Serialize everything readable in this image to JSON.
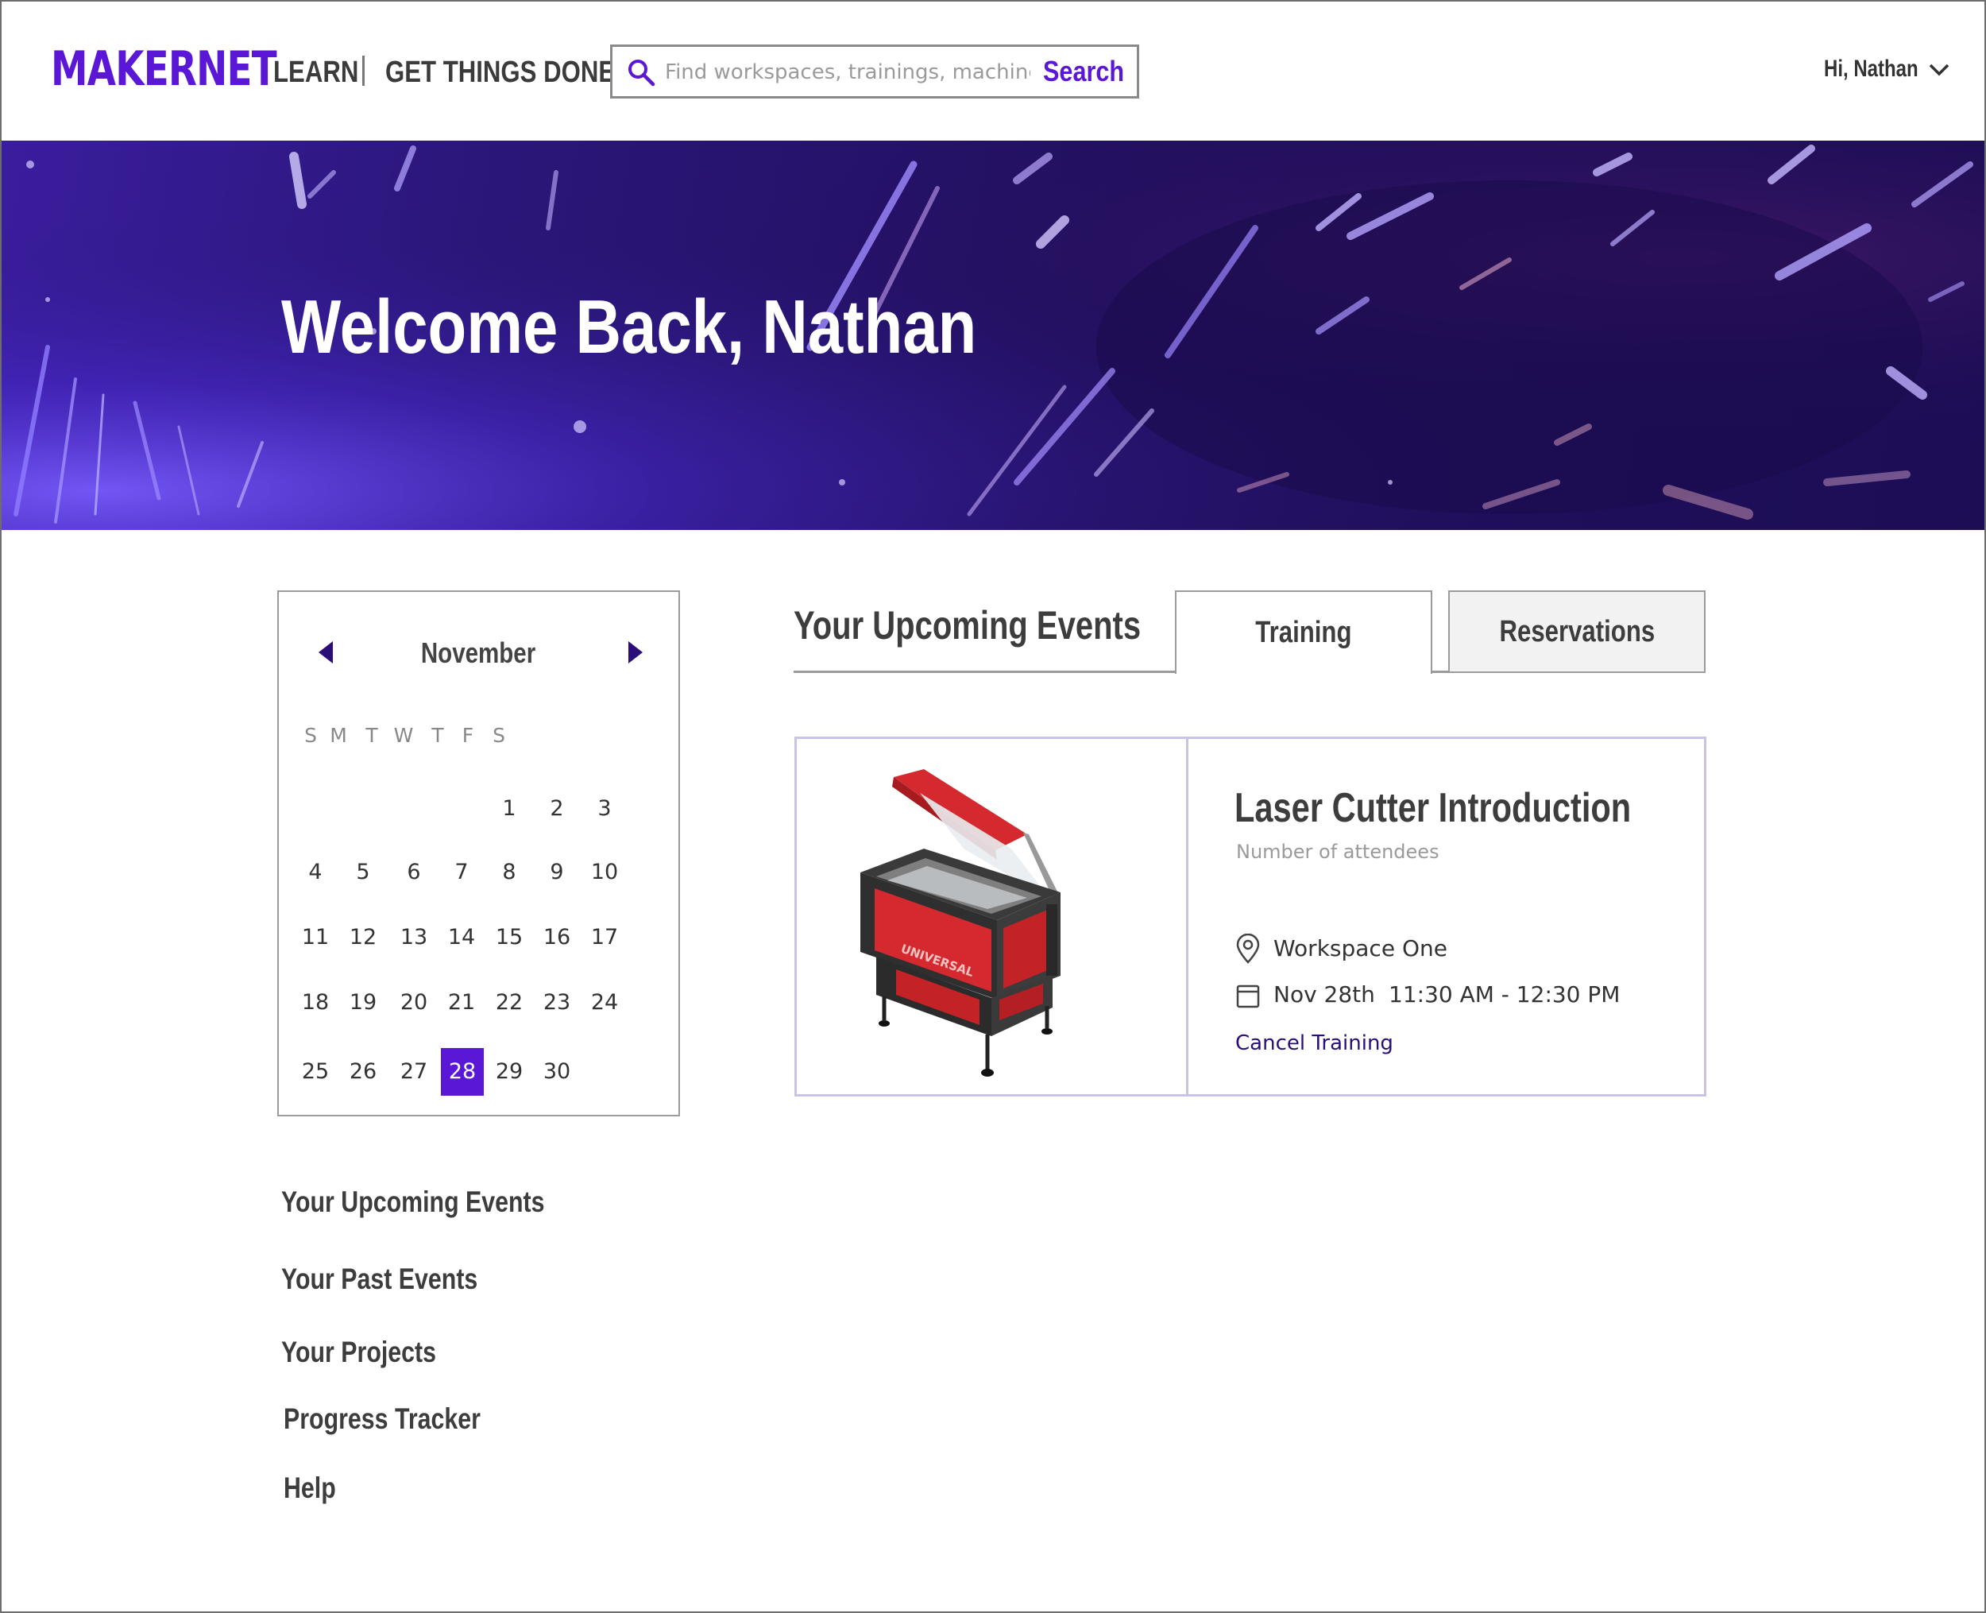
{
  "header": {
    "logo": "MAKERNET",
    "nav": {
      "learn": "LEARN",
      "get_things_done": "GET THINGS DONE"
    },
    "search": {
      "placeholder": "Find workspaces, trainings, machines ...",
      "button": "Search"
    },
    "user": {
      "greeting": "Hi, Nathan"
    }
  },
  "hero": {
    "title": "Welcome Back, Nathan"
  },
  "calendar": {
    "month": "November",
    "weekdays": [
      "S",
      "M",
      "T",
      "W",
      "T",
      "F",
      "S"
    ],
    "weeks": [
      [
        "",
        "",
        "",
        "",
        "1",
        "2",
        "3"
      ],
      [
        "4",
        "5",
        "6",
        "7",
        "8",
        "9",
        "10"
      ],
      [
        "11",
        "12",
        "13",
        "14",
        "15",
        "16",
        "17"
      ],
      [
        "18",
        "19",
        "20",
        "21",
        "22",
        "23",
        "24"
      ],
      [
        "25",
        "26",
        "27",
        "28",
        "29",
        "30",
        ""
      ]
    ],
    "selected": "28"
  },
  "sidebar": {
    "items": [
      {
        "label": "Your Upcoming Events",
        "active": true
      },
      {
        "label": "Your Past Events",
        "active": false
      },
      {
        "label": "Your Projects",
        "active": false
      },
      {
        "label": "Progress Tracker",
        "active": false
      },
      {
        "label": "Help",
        "active": false
      }
    ]
  },
  "events": {
    "title": "Your Upcoming Events",
    "tabs": [
      {
        "label": "Training",
        "active": true
      },
      {
        "label": "Reservations",
        "active": false
      }
    ],
    "card": {
      "title": "Laser Cutter Introduction",
      "subtitle": "Number of attendees",
      "location": "Workspace One",
      "date": "Nov 28th",
      "time": "11:30 AM - 12:30 PM",
      "action": "Cancel Training",
      "image_icon": "laser-cutter-image"
    }
  },
  "colors": {
    "accent": "#5a18d6",
    "hero": "#221060",
    "card_border": "#c9c3ea",
    "link": "#2a0f7a"
  }
}
